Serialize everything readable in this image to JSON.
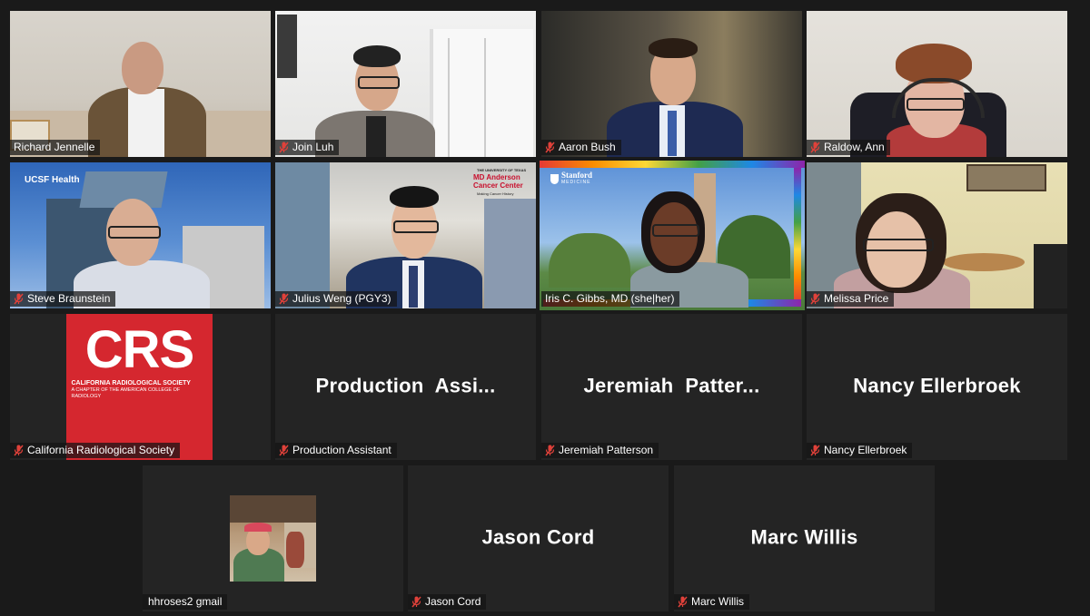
{
  "participants": [
    {
      "name": "Richard Jennelle",
      "muted": false
    },
    {
      "name": "Join Luh",
      "muted": true
    },
    {
      "name": "Aaron Bush",
      "muted": true
    },
    {
      "name": "Raldow, Ann",
      "muted": true
    },
    {
      "name": "Steve Braunstein",
      "muted": true,
      "logo": "UCSF Health"
    },
    {
      "name": "Julius Weng (PGY3)",
      "muted": true,
      "logo": "MD Anderson Cancer Center",
      "logo_top": "THE UNIVERSITY OF TEXAS",
      "logo_sub": "Making Cancer History"
    },
    {
      "name": "Iris C. Gibbs, MD (she|her)",
      "muted": true,
      "logo": "Stanford",
      "logo_sub": "MEDICINE"
    },
    {
      "name": "Melissa Price",
      "muted": true
    },
    {
      "name": "California Radiological Society",
      "muted": true,
      "card_big": "CRS",
      "card_line1": "CALIFORNIA RADIOLOGICAL SOCIETY",
      "card_line2": "A CHAPTER OF THE AMERICAN COLLEGE OF RADIOLOGY"
    },
    {
      "name": "Production Assistant",
      "muted": true,
      "display": "Production  Assi..."
    },
    {
      "name": "Jeremiah Patterson",
      "muted": true,
      "display": "Jeremiah  Patter..."
    },
    {
      "name": "Nancy Ellerbroek",
      "muted": true,
      "display": "Nancy Ellerbroek"
    },
    {
      "name": "hhroses2 gmail",
      "muted": false
    },
    {
      "name": "Jason Cord",
      "muted": true,
      "display": "Jason Cord"
    },
    {
      "name": "Marc Willis",
      "muted": true,
      "display": "Marc Willis"
    }
  ],
  "colors": {
    "background": "#1a1a1a",
    "tile": "#242424",
    "active_speaker": "#f3e25b",
    "muted_icon": "#e0413a",
    "crs_red": "#d5272f"
  },
  "icons": {
    "muted": "microphone-muted-icon"
  }
}
